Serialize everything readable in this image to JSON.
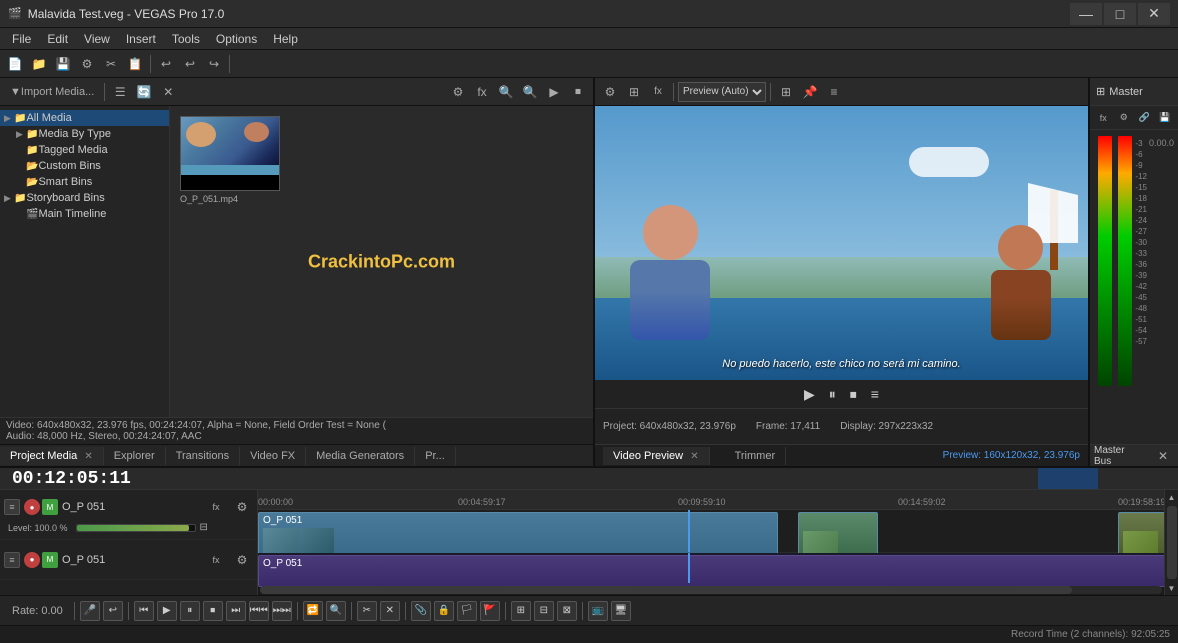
{
  "window": {
    "title": "Malavida Test.veg - VEGAS Pro 17.0",
    "icon": "🎬"
  },
  "titlebar": {
    "title": "Malavida Test.veg - VEGAS Pro 17.0",
    "controls": [
      "—",
      "□",
      "✕"
    ]
  },
  "menubar": {
    "items": [
      "File",
      "Edit",
      "View",
      "Insert",
      "Tools",
      "Options",
      "Help"
    ]
  },
  "left_panel": {
    "toolbar_label": "Import Media...",
    "tree": {
      "items": [
        {
          "id": "all-media",
          "label": "All Media",
          "icon": "📁",
          "level": 0,
          "selected": true
        },
        {
          "id": "media-by-type",
          "label": "Media By Type",
          "icon": "📁",
          "level": 1
        },
        {
          "id": "tagged-media",
          "label": "Tagged Media",
          "icon": "📁",
          "level": 1
        },
        {
          "id": "custom-bins",
          "label": "Custom Bins",
          "icon": "📂",
          "level": 1
        },
        {
          "id": "smart-bins",
          "label": "Smart Bins",
          "icon": "📂",
          "level": 1
        },
        {
          "id": "storyboard-bins",
          "label": "Storyboard Bins",
          "icon": "📁",
          "level": 0,
          "expanded": true
        },
        {
          "id": "main-timeline",
          "label": "Main Timeline",
          "icon": "🎬",
          "level": 1
        }
      ]
    },
    "media_file": {
      "name": "O_P_051.mp4",
      "thumb_label": "O_P_051.mp4"
    },
    "info_line1": "Video: 640x480x32, 23.976 fps, 00:24:24:07, Alpha = None, Field Order Test = None (",
    "info_line2": "Audio: 48,000 Hz, Stereo, 00:24:24:07, AAC"
  },
  "tabs": {
    "left": [
      {
        "label": "Project Media",
        "active": true,
        "closeable": true
      },
      {
        "label": "Explorer"
      },
      {
        "label": "Transitions"
      },
      {
        "label": "Video FX"
      },
      {
        "label": "Media Generators"
      },
      {
        "label": "Pr..."
      }
    ],
    "right": [
      {
        "label": "Video Preview",
        "active": true,
        "closeable": true
      },
      {
        "label": "Trimmer"
      }
    ]
  },
  "preview": {
    "toolbar_label": "Preview (Auto)",
    "subtitle": "No puedo hacerlo, este chico no será mi camino.",
    "project_info": "Project: 640x480x32, 23.976p",
    "frame_info": "Frame:  17,411",
    "display_info": "Display:  297x223x32",
    "preview_size": "Preview: 160x120x32, 23.976p",
    "controls": [
      "▶",
      "⏸",
      "⏹",
      "≡"
    ]
  },
  "master_panel": {
    "title": "Master",
    "label": "Master Bus",
    "meter_labels": [
      "-3",
      "-6",
      "-9",
      "-12",
      "-15",
      "-18",
      "-21",
      "-24",
      "-27",
      "-30",
      "-33",
      "-36",
      "-39",
      "-42",
      "-45",
      "-48",
      "-51",
      "-54",
      "-57"
    ],
    "values": [
      "0.0",
      "0.0"
    ]
  },
  "timeline": {
    "timecode": "00:12:05:11",
    "tracks": [
      {
        "name": "O_P 051",
        "type": "video",
        "level": "Level: 100.0 %",
        "clips": [
          {
            "label": "O_P 051",
            "start_pct": 0,
            "width_pct": 55,
            "color": "#4a7a9a"
          },
          {
            "label": "",
            "start_pct": 57,
            "width_pct": 8,
            "color": "#5a8a6a"
          },
          {
            "label": "",
            "start_pct": 92,
            "width_pct": 8,
            "color": "#5a6a4a"
          }
        ]
      },
      {
        "name": "O_P 051",
        "type": "audio",
        "clips": [
          {
            "label": "O_P 051",
            "start_pct": 0,
            "width_pct": 100,
            "color": "#5a4a8a"
          }
        ]
      }
    ],
    "ruler": {
      "marks": [
        "00:00:00",
        "00:04:59:17",
        "00:09:59:10",
        "00:14:59:02",
        "00:19:58:19"
      ]
    }
  },
  "transport": {
    "buttons": [
      "🎤",
      "↩",
      "⏮",
      "▶",
      "⏸",
      "⏹",
      "⏭",
      "⏮⏮",
      "⏭⏭",
      "⊡",
      "⊞",
      "✕",
      "⊟"
    ],
    "rate_label": "Rate: 0.00"
  },
  "status": {
    "record_time": "Record Time (2 channels): 92:05:25"
  }
}
